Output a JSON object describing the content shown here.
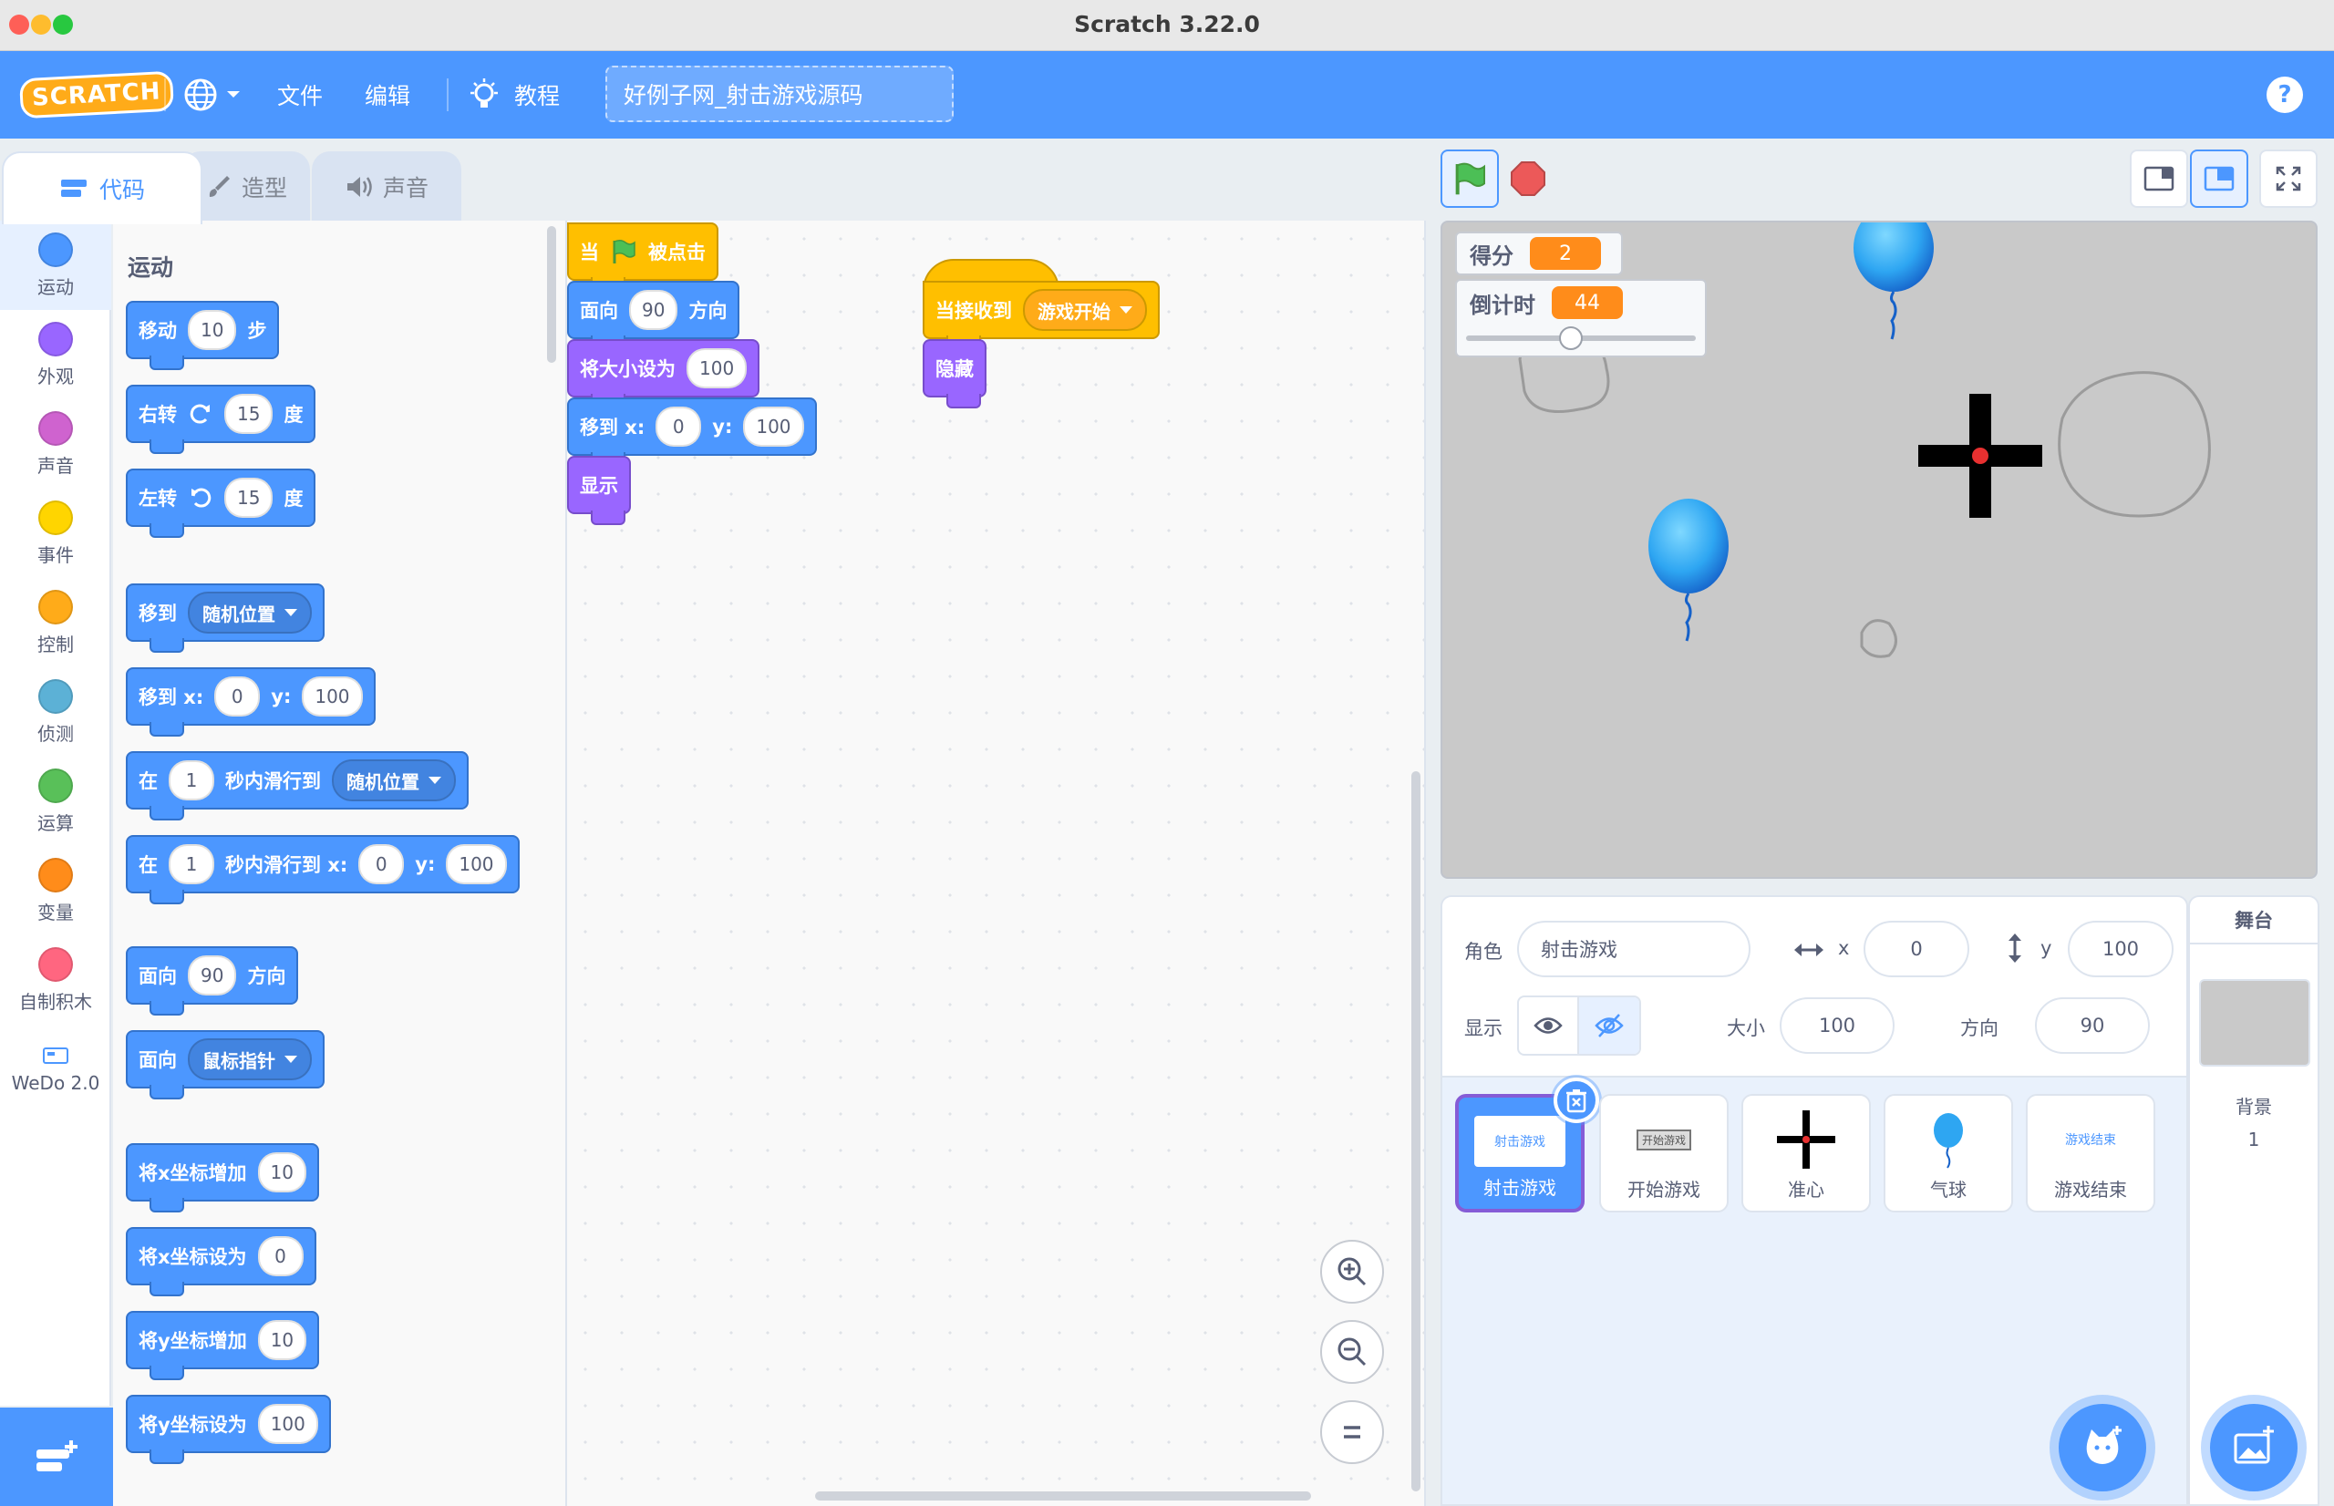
{
  "window": {
    "title": "Scratch 3.22.0"
  },
  "menubar": {
    "logo": "SCRATCH",
    "file": "文件",
    "edit": "编辑",
    "tutorials": "教程",
    "project_title": "好例子网_射击游戏源码",
    "icons": [
      "globe-icon",
      "lightbulb-icon",
      "help-icon"
    ]
  },
  "tabs": {
    "code": "代码",
    "costumes": "造型",
    "sounds": "声音"
  },
  "categories": [
    {
      "label": "运动",
      "color": "#4c97ff"
    },
    {
      "label": "外观",
      "color": "#9966ff"
    },
    {
      "label": "声音",
      "color": "#cf63cf"
    },
    {
      "label": "事件",
      "color": "#ffd500"
    },
    {
      "label": "控制",
      "color": "#ffab19"
    },
    {
      "label": "侦测",
      "color": "#5cb1d6"
    },
    {
      "label": "运算",
      "color": "#59c059"
    },
    {
      "label": "变量",
      "color": "#ff8c1a"
    },
    {
      "label": "自制积木",
      "color": "#ff6680"
    },
    {
      "label": "WeDo 2.0",
      "color": ""
    }
  ],
  "palette": {
    "heading": "运动",
    "move": {
      "a": "移动",
      "n": "10",
      "b": "步"
    },
    "turn_right": {
      "a": "右转",
      "n": "15",
      "b": "度"
    },
    "turn_left": {
      "a": "左转",
      "n": "15",
      "b": "度"
    },
    "goto": {
      "a": "移到",
      "dd": "随机位置"
    },
    "goto_xy": {
      "a": "移到 x:",
      "x": "0",
      "yl": "y:",
      "y": "100"
    },
    "glide": {
      "a": "在",
      "n": "1",
      "b": "秒内滑行到",
      "dd": "随机位置"
    },
    "glide_xy": {
      "a": "在",
      "n": "1",
      "b": "秒内滑行到 x:",
      "x": "0",
      "yl": "y:",
      "y": "100"
    },
    "point_dir": {
      "a": "面向",
      "n": "90",
      "b": "方向"
    },
    "point_towards": {
      "a": "面向",
      "dd": "鼠标指针"
    },
    "change_x": {
      "a": "将x坐标增加",
      "n": "10"
    },
    "set_x": {
      "a": "将x坐标设为",
      "n": "0"
    },
    "change_y": {
      "a": "将y坐标增加",
      "n": "10"
    },
    "set_y": {
      "a": "将y坐标设为",
      "n": "100"
    }
  },
  "script1": {
    "hat": {
      "a": "当",
      "b": "被点击"
    },
    "point": {
      "a": "面向",
      "n": "90",
      "b": "方向"
    },
    "size": {
      "a": "将大小设为",
      "n": "100"
    },
    "goto": {
      "a": "移到 x:",
      "x": "0",
      "yl": "y:",
      "y": "100"
    },
    "show": "显示"
  },
  "script2": {
    "hat": {
      "a": "当接收到",
      "dd": "游戏开始"
    },
    "hide": "隐藏"
  },
  "stage": {
    "monitors": [
      {
        "label": "得分",
        "value": "2"
      },
      {
        "label": "倒计时",
        "value": "44",
        "slider_fraction": 0.45
      }
    ]
  },
  "sprite_info": {
    "sprite_label": "角色",
    "sprite_name": "射击游戏",
    "x_label": "x",
    "x": "0",
    "y_label": "y",
    "y": "100",
    "show_label": "显示",
    "size_label": "大小",
    "size": "100",
    "direction_label": "方向",
    "direction": "90"
  },
  "sprites": [
    {
      "name": "射击游戏",
      "thumb": "射击游戏",
      "selected": true
    },
    {
      "name": "开始游戏",
      "thumb": "开始游戏"
    },
    {
      "name": "准心",
      "thumb": ""
    },
    {
      "name": "气球",
      "thumb": ""
    },
    {
      "name": "游戏结束",
      "thumb": "游戏结束"
    }
  ],
  "stage_panel": {
    "title": "舞台",
    "backdrops_label": "背景",
    "backdrops_count": "1"
  },
  "colors": {
    "accent": "#4c97ff",
    "motion": "#4c97ff",
    "looks": "#9966ff",
    "events": "#ffbf00",
    "variable": "#ff8c1a"
  }
}
